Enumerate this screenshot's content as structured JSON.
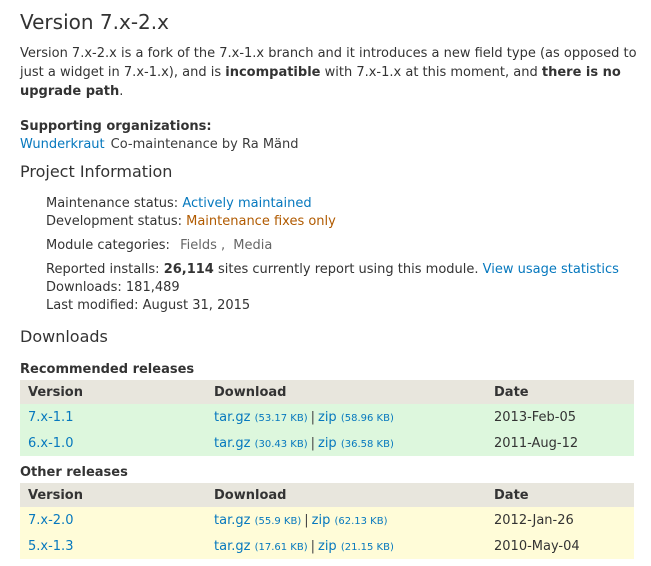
{
  "title": "Version 7.x-2.x",
  "intro": {
    "p1": "Version 7.x-2.x is a fork of the 7.x-1.x branch and it introduces a new field type (as opposed to just a widget in 7.x-1.x), and is ",
    "b1": "incompatible",
    "p2": " with 7.x-1.x at this moment, and ",
    "b2": "there is no upgrade path",
    "p3": "."
  },
  "supporting": {
    "label": "Supporting organizations:",
    "org": "Wunderkraut",
    "desc": "Co-maintenance by Ra Mänd"
  },
  "project_info": {
    "heading": "Project Information",
    "maintenance_label": "Maintenance status: ",
    "maintenance_value": "Actively maintained",
    "development_label": "Development status: ",
    "development_value": "Maintenance fixes only",
    "categories_label": "Module categories:",
    "categories": [
      "Fields",
      "Media"
    ],
    "installs_label": "Reported installs: ",
    "installs_count": "26,114",
    "installs_text": " sites currently report using this module. ",
    "usage_link": "View usage statistics",
    "downloads_text": "Downloads: 181,489",
    "last_modified": "Last modified: August 31, 2015"
  },
  "downloads": {
    "heading": "Downloads",
    "col_version": "Version",
    "col_download": "Download",
    "col_date": "Date",
    "recommended": {
      "heading": "Recommended releases",
      "rows": [
        {
          "version": "7.x-1.1",
          "tgz": "tar.gz",
          "tgz_size": "(53.17 KB)",
          "zip": "zip",
          "zip_size": "(58.96 KB)",
          "date": "2013-Feb-05"
        },
        {
          "version": "6.x-1.0",
          "tgz": "tar.gz",
          "tgz_size": "(30.43 KB)",
          "zip": "zip",
          "zip_size": "(36.58 KB)",
          "date": "2011-Aug-12"
        }
      ]
    },
    "other": {
      "heading": "Other releases",
      "rows": [
        {
          "version": "7.x-2.0",
          "tgz": "tar.gz",
          "tgz_size": "(55.9 KB)",
          "zip": "zip",
          "zip_size": "(62.13 KB)",
          "date": "2012-Jan-26"
        },
        {
          "version": "5.x-1.3",
          "tgz": "tar.gz",
          "tgz_size": "(17.61 KB)",
          "zip": "zip",
          "zip_size": "(21.15 KB)",
          "date": "2010-May-04"
        }
      ]
    },
    "separator": "|"
  }
}
